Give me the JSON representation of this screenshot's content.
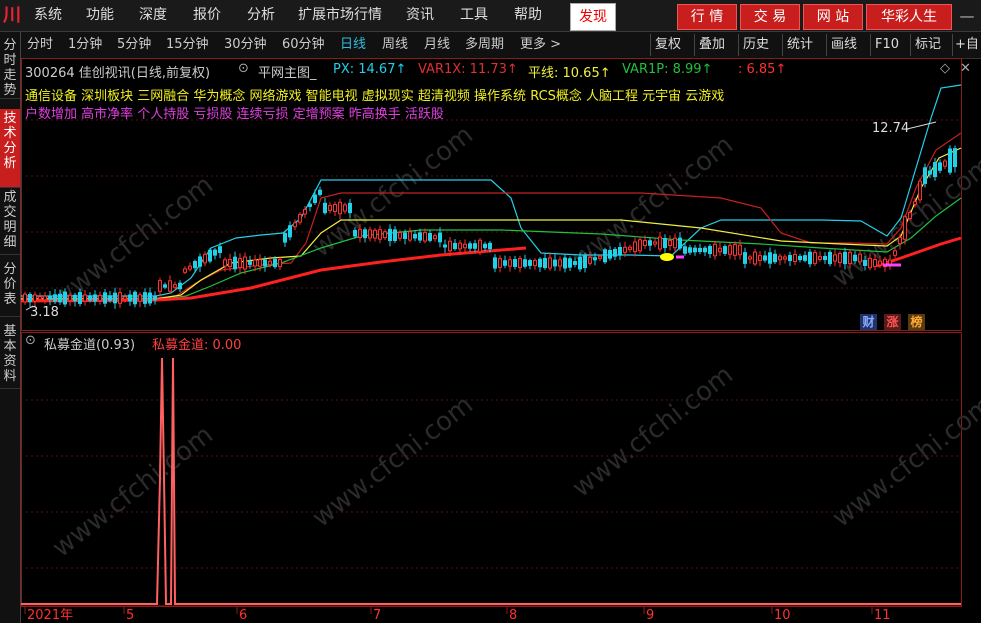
{
  "menu": {
    "logo": "川",
    "items": [
      "系统",
      "功能",
      "深度",
      "报价",
      "分析",
      "扩展市场行情",
      "资讯",
      "工具",
      "帮助"
    ],
    "discover": "发现",
    "right_buttons": [
      "行 情",
      "交 易",
      "网 站",
      "华彩人生"
    ],
    "win_controls": [
      "—",
      "□",
      "✕"
    ]
  },
  "side_tabs": [
    "分时走势",
    "技术分析",
    "成交明细",
    "分价表",
    "基本资料"
  ],
  "periods": [
    "分时",
    "1分钟",
    "5分钟",
    "15分钟",
    "30分钟",
    "60分钟",
    "日线",
    "周线",
    "月线",
    "多周期",
    "更多 >"
  ],
  "active_period": "日线",
  "toolbar": [
    "复权",
    "叠加",
    "历史",
    "统计",
    "画线",
    "F10",
    "标记",
    "+自"
  ],
  "stock": {
    "title": "300264 佳创视讯(日线,前复权)",
    "indicator_name": "平网主图_",
    "legend": [
      {
        "label": "PX: 14.67↑",
        "color": "#22d0e8"
      },
      {
        "label": "VAR1X: 11.73↑",
        "color": "#e03030"
      },
      {
        "label": "平线: 10.65↑",
        "color": "#f0f040"
      },
      {
        "label": "VAR1P: 8.99↑",
        "color": "#20c040"
      },
      {
        "label": ": 6.85↑",
        "color": "#ff3030"
      }
    ]
  },
  "concepts_line1": "通信设备   深圳板块  三网融合  华为概念  网络游戏  智能电视  虚拟现实  超清视频  操作系统  RCS概念  人脑工程  元宇宙  云游戏",
  "concepts_line2": "户数增加  高市净率  个人持股  亏损股  连续亏损  定增预案  昨高换手  活跃股",
  "price_labels": {
    "high": "12.74",
    "low": "3.18"
  },
  "badges": [
    {
      "label": "财",
      "color": "#3a7aff"
    },
    {
      "label": "涨",
      "color": "#ff3030"
    },
    {
      "label": "榜",
      "color": "#ffaa33"
    }
  ],
  "sub_panel": {
    "title": "私募金道(0.93)",
    "value_label": "私募金道: 0.00"
  },
  "time_axis": [
    "2021年",
    "5",
    "6",
    "7",
    "8",
    "9",
    "10",
    "11"
  ],
  "watermark": "www.cfchi.com",
  "chart_data": {
    "type": "line",
    "lines": [
      "PX",
      "VAR1X",
      "平线",
      "VAR1P",
      "MA"
    ],
    "y_range": [
      3.18,
      14.67
    ],
    "sub_spike_position": "early May 2021"
  }
}
